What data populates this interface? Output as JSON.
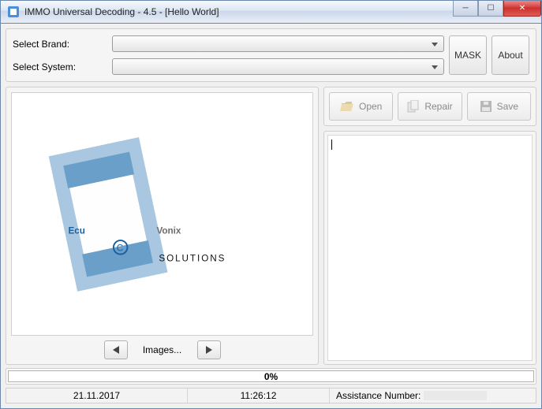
{
  "window": {
    "title": "IMMO Universal Decoding - 4.5 - [Hello World]"
  },
  "topPanel": {
    "brandLabel": "Select Brand:",
    "systemLabel": "Select System:",
    "maskBtn": "MASK",
    "aboutBtn": "About"
  },
  "toolbar": {
    "open": "Open",
    "repair": "Repair",
    "save": "Save"
  },
  "imageNav": {
    "label": "Images..."
  },
  "log": {
    "content": ""
  },
  "progress": {
    "text": "0%",
    "value": 0
  },
  "status": {
    "date": "21.11.2017",
    "time": "11:26:12",
    "assistLabel": "Assistance Number:",
    "assistValue": ""
  },
  "logo": {
    "line1a": "Ecu",
    "line1b": "Vonix",
    "line2": "SOLUTIONS"
  }
}
